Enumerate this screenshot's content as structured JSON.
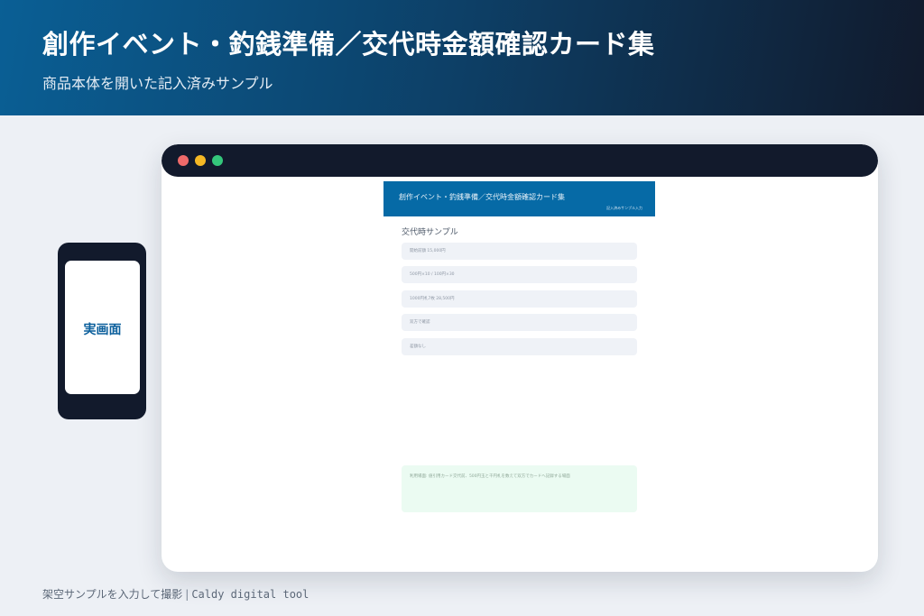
{
  "hero": {
    "title": "創作イベント・釣銭準備／交代時金額確認カード集",
    "subtitle": "商品本体を開いた記入済みサンプル"
  },
  "browser": {
    "controls": [
      "red",
      "yellow",
      "green"
    ],
    "app": {
      "header_title": "創作イベント・釣銭準備／交代時金額確認カード集",
      "header_badge": "記入済みサンプル入力",
      "section_title": "交代時サンプル",
      "fields": [
        "開始前額 15,000円",
        "500円×10 / 100円×30",
        "1000円札7枚 28,500円",
        "双方で確認",
        "差額なし"
      ],
      "note": "利用場面: 値引用カード交代前、500円玉と千円札を数えて双方でカードへ記録する場面"
    }
  },
  "phone": {
    "label": "実画面"
  },
  "footer": {
    "caption": "架空サンプルを入力して撮影",
    "separator": "|",
    "tool": "Caldy digital tool"
  },
  "colors": {
    "hero_start": "#0a5f95",
    "hero_end": "#111a2c",
    "app_header": "#066aa6",
    "note_bg": "#ebfbf2",
    "phone_label": "#0b5f9c"
  }
}
